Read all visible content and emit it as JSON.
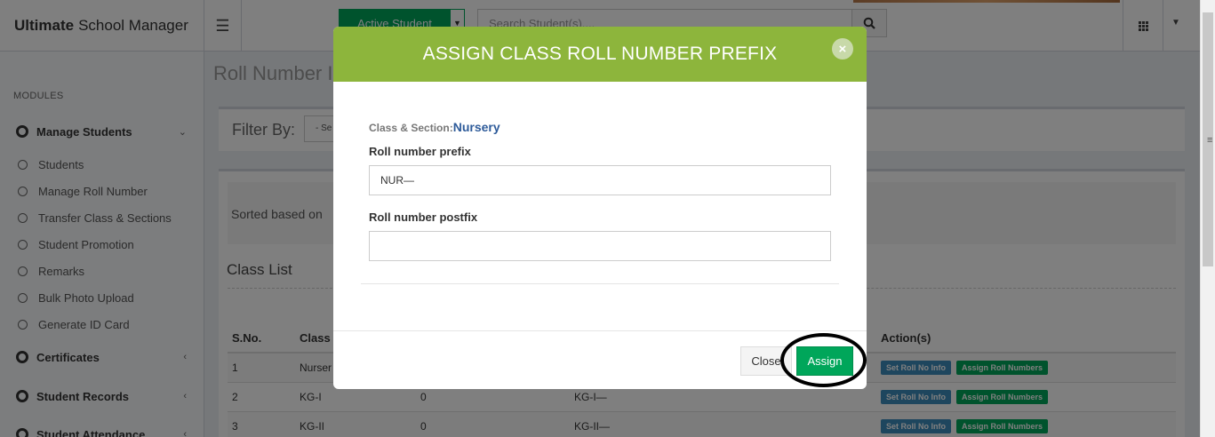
{
  "header": {
    "brand_bold": "Ultimate",
    "brand_rest": "School Manager",
    "active_button": "Active Student",
    "search_placeholder": "Search Student(s)...."
  },
  "sidebar": {
    "modules_header": "MODULES",
    "parents": [
      {
        "label": "Manage Students",
        "chevron": "⌄"
      },
      {
        "label": "Certificates",
        "chevron": "‹"
      },
      {
        "label": "Student Records",
        "chevron": "‹"
      },
      {
        "label": "Student Attendance",
        "chevron": "‹"
      }
    ],
    "children": [
      "Students",
      "Manage Roll Number",
      "Transfer Class & Sections",
      "Student Promotion",
      "Remarks",
      "Bulk Photo Upload",
      "Generate ID Card"
    ]
  },
  "main": {
    "page_title": "Roll Number I",
    "filter_label": "Filter By:",
    "filter_select": "- Se",
    "sorted_text": "Sorted based on",
    "class_list_title": "Class List",
    "table": {
      "headers": [
        "S.No.",
        "Class N",
        "",
        "",
        "",
        "Action(s)"
      ],
      "rows": [
        {
          "sno": "1",
          "cls": "Nurser",
          "count": "",
          "prefix": ""
        },
        {
          "sno": "2",
          "cls": "KG-I",
          "count": "0",
          "prefix": "KG-I—"
        },
        {
          "sno": "3",
          "cls": "KG-II",
          "count": "0",
          "prefix": "KG-II—"
        }
      ],
      "btn_set": "Set Roll No Info",
      "btn_assign": "Assign Roll Numbers"
    }
  },
  "modal": {
    "title": "ASSIGN CLASS ROLL NUMBER PREFIX",
    "close_x": "×",
    "class_section_label": "Class & Section:",
    "class_section_value": "Nursery",
    "prefix_label": "Roll number prefix",
    "prefix_value": "NUR—",
    "postfix_label": "Roll number postfix",
    "postfix_value": "",
    "close_button": "Close",
    "assign_button": "Assign"
  },
  "colors": {
    "modal_header": "#8db53c",
    "success": "#00a65a",
    "info": "#3c8dbc",
    "class_value": "#2e5b9a"
  }
}
